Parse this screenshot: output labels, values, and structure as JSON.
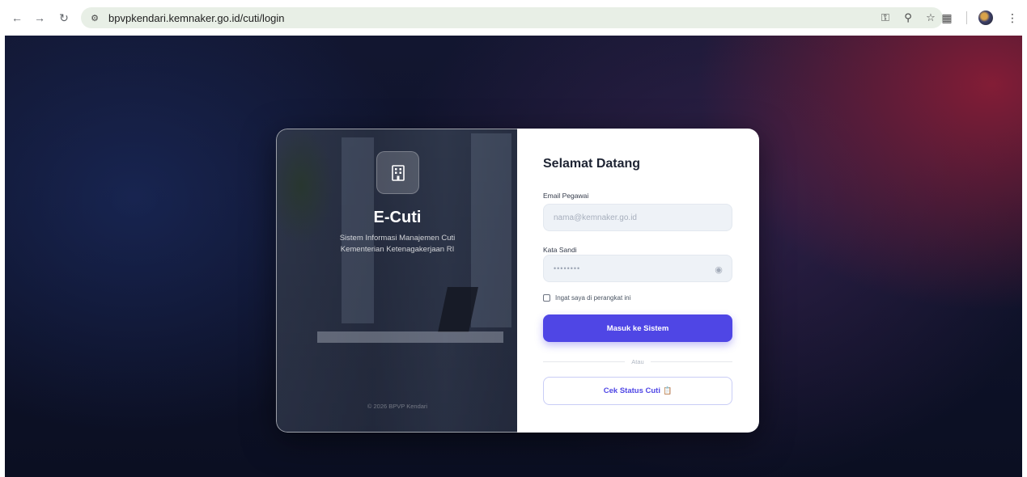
{
  "browser": {
    "url": "bpvpkendari.kemnaker.go.id/cuti/login",
    "icons": [
      "back-arrow-icon",
      "forward-arrow-icon",
      "reload-icon",
      "site-settings-icon",
      "password-key-icon",
      "zoom-icon",
      "bookmark-star-icon",
      "extensions-icon",
      "profile-avatar",
      "menu-dots-icon"
    ]
  },
  "brand": {
    "title": "E-Cuti",
    "subtitle_line1": "Sistem Informasi Manajemen Cuti",
    "subtitle_line2": "Kementerian Ketenagakerjaan RI",
    "footer": "© 2026 BPVP Kendari",
    "logo_icon": "building-icon"
  },
  "login": {
    "title": "Selamat Datang",
    "email_label": "Email Pegawai",
    "email_placeholder": "nama@kemnaker.go.id",
    "password_label": "Kata Sandi",
    "password_value": "••••••••",
    "remember_label": "Ingat saya di perangkat ini",
    "remember_checked": false,
    "submit_label": "Masuk ke Sistem",
    "divider_text": "Atau",
    "status_button_label": "Cek Status Cuti"
  },
  "colors": {
    "primary": "#4f46e5",
    "background_dark": "#0e1229",
    "accent_red": "#961e37"
  }
}
